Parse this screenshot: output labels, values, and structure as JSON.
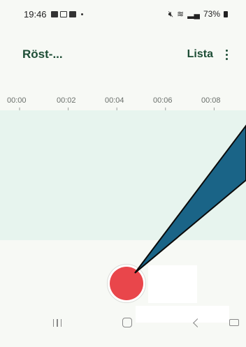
{
  "status_bar": {
    "time": "19:46",
    "right_text": "73%",
    "icons": [
      "image-icon",
      "calendar-icon",
      "facebook-icon",
      "dot-icon",
      "mute-icon",
      "wifi-icon",
      "signal-icon",
      "battery-icon"
    ]
  },
  "app_bar": {
    "title": "Röst-...",
    "list_label": "Lista",
    "more_icon": "more-vert-icon"
  },
  "timeline": {
    "labels": [
      "00:00",
      "00:02",
      "00:04",
      "00:06",
      "00:08"
    ]
  },
  "colors": {
    "accent": "#1d4d35",
    "record": "#e9464b",
    "wave_bg": "#e7f4ee",
    "annotation": "#1a6487"
  },
  "controls": {
    "record_icon": "record-icon"
  },
  "nav_bar": {
    "icons": [
      "recents-icon",
      "home-icon",
      "back-icon",
      "keyboard-icon"
    ]
  }
}
